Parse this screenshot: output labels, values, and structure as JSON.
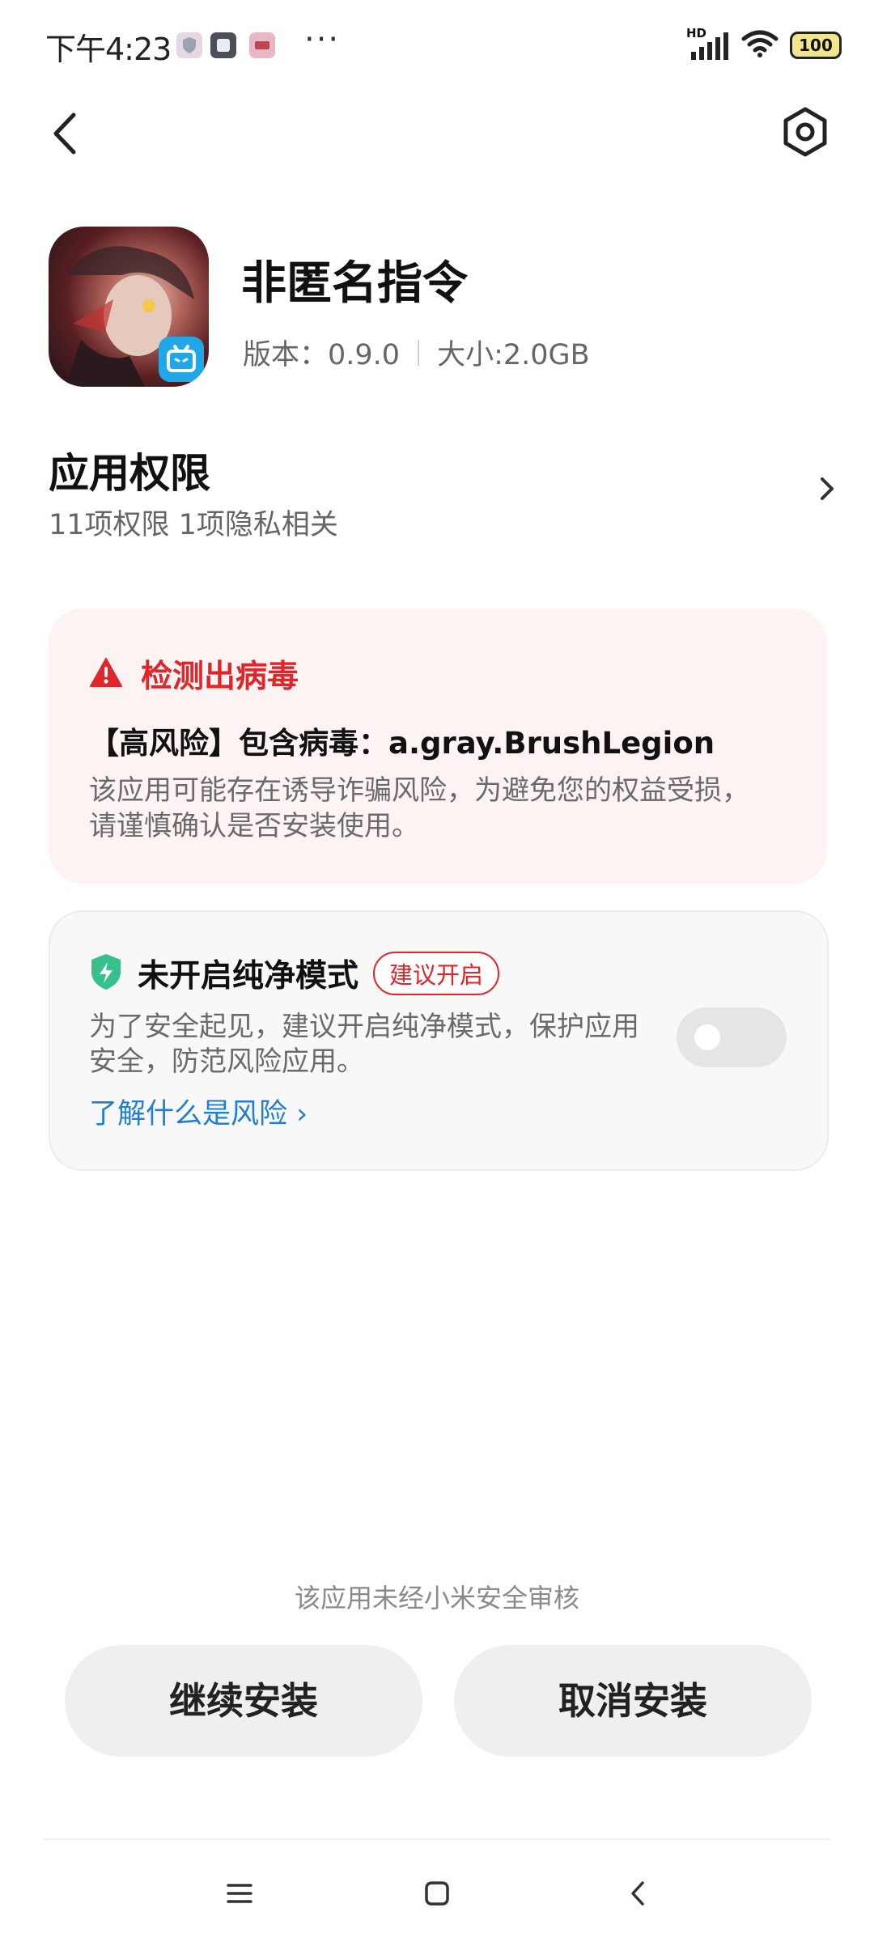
{
  "status_bar": {
    "time": "下午4:23",
    "more": "···",
    "network_label": "HD",
    "battery": "100"
  },
  "app": {
    "name": "非匿名指令",
    "version": "版本：0.9.0",
    "size": "大小:2.0GB"
  },
  "permissions": {
    "title": "应用权限",
    "subtitle": "11项权限 1项隐私相关"
  },
  "virus": {
    "heading": "检测出病毒",
    "name": "【高风险】包含病毒：a.gray.BrushLegion",
    "description": "该应用可能存在诱导诈骗风险，为避免您的权益受损，请谨慎确认是否安装使用。"
  },
  "pure_mode": {
    "title": "未开启纯净模式",
    "tag": "建议开启",
    "description": "为了安全起见，建议开启纯净模式，保护应用安全，防范风险应用。",
    "link": "了解什么是风险 ›",
    "toggle_on": false
  },
  "footer": {
    "notice": "该应用未经小米安全审核",
    "continue_label": "继续安装",
    "cancel_label": "取消安装"
  },
  "colors": {
    "danger": "#e0262a",
    "link": "#1f7fd6",
    "shield": "#38c08a"
  }
}
